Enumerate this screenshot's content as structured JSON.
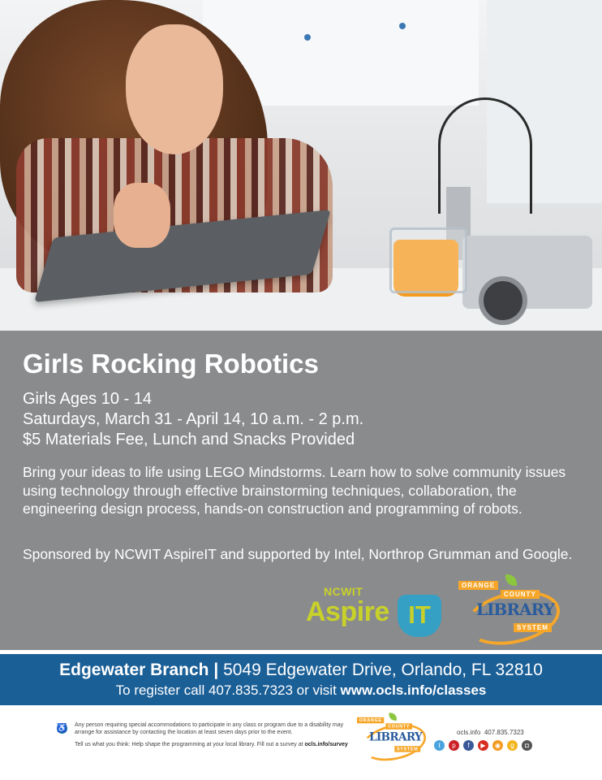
{
  "event": {
    "title": "Girls Rocking Robotics",
    "details": [
      "Girls Ages 10 - 14",
      "Saturdays, March 31 - April 14, 10 a.m. - 2 p.m.",
      "$5 Materials Fee, Lunch and Snacks Provided"
    ],
    "description": "Bring your ideas to life using LEGO Mindstorms. Learn how to solve community issues using technology through effective brainstorming techniques, collaboration, the engineering design process, hands-on construction and programming of robots.",
    "sponsors": "Sponsored by NCWIT AspireIT and supported by Intel, Northrop Grumman and Google."
  },
  "logos": {
    "ncwit_small": "NCWIT",
    "ncwit_aspire": "Aspire",
    "ncwit_it": "IT",
    "ocls_orange": "ORANGE",
    "ocls_county": "COUNTY",
    "ocls_library": "LIBRARY",
    "ocls_system": "SYSTEM"
  },
  "location": {
    "branch": "Edgewater Branch",
    "separator": "|",
    "address": "5049 Edgewater Drive, Orlando, FL 32810",
    "register_text": "To register call 407.835.7323 or visit",
    "register_url": "www.ocls.info/classes"
  },
  "footer": {
    "disclaimer": "Any person requiring special accommodations to participate in any class or program due to a disability may arrange for assistance by contacting the location at least seven days prior to the event.",
    "survey_text": "Tell us what you think: Help shape the programming at your local library. Fill out a survey at",
    "survey_url": "ocls.info/survey",
    "site": "ocls.info",
    "phone": "407.835.7323"
  },
  "colors": {
    "band_gray": "#8a8b8d",
    "blue_bar": "#1b5f97",
    "ncwit_green": "#c8d12a",
    "ocls_orange": "#f6a72a"
  },
  "social_icons": [
    "twitter-icon",
    "pinterest-icon",
    "facebook-icon",
    "youtube-icon",
    "rss-icon",
    "goodreads-icon",
    "instagram-icon"
  ]
}
